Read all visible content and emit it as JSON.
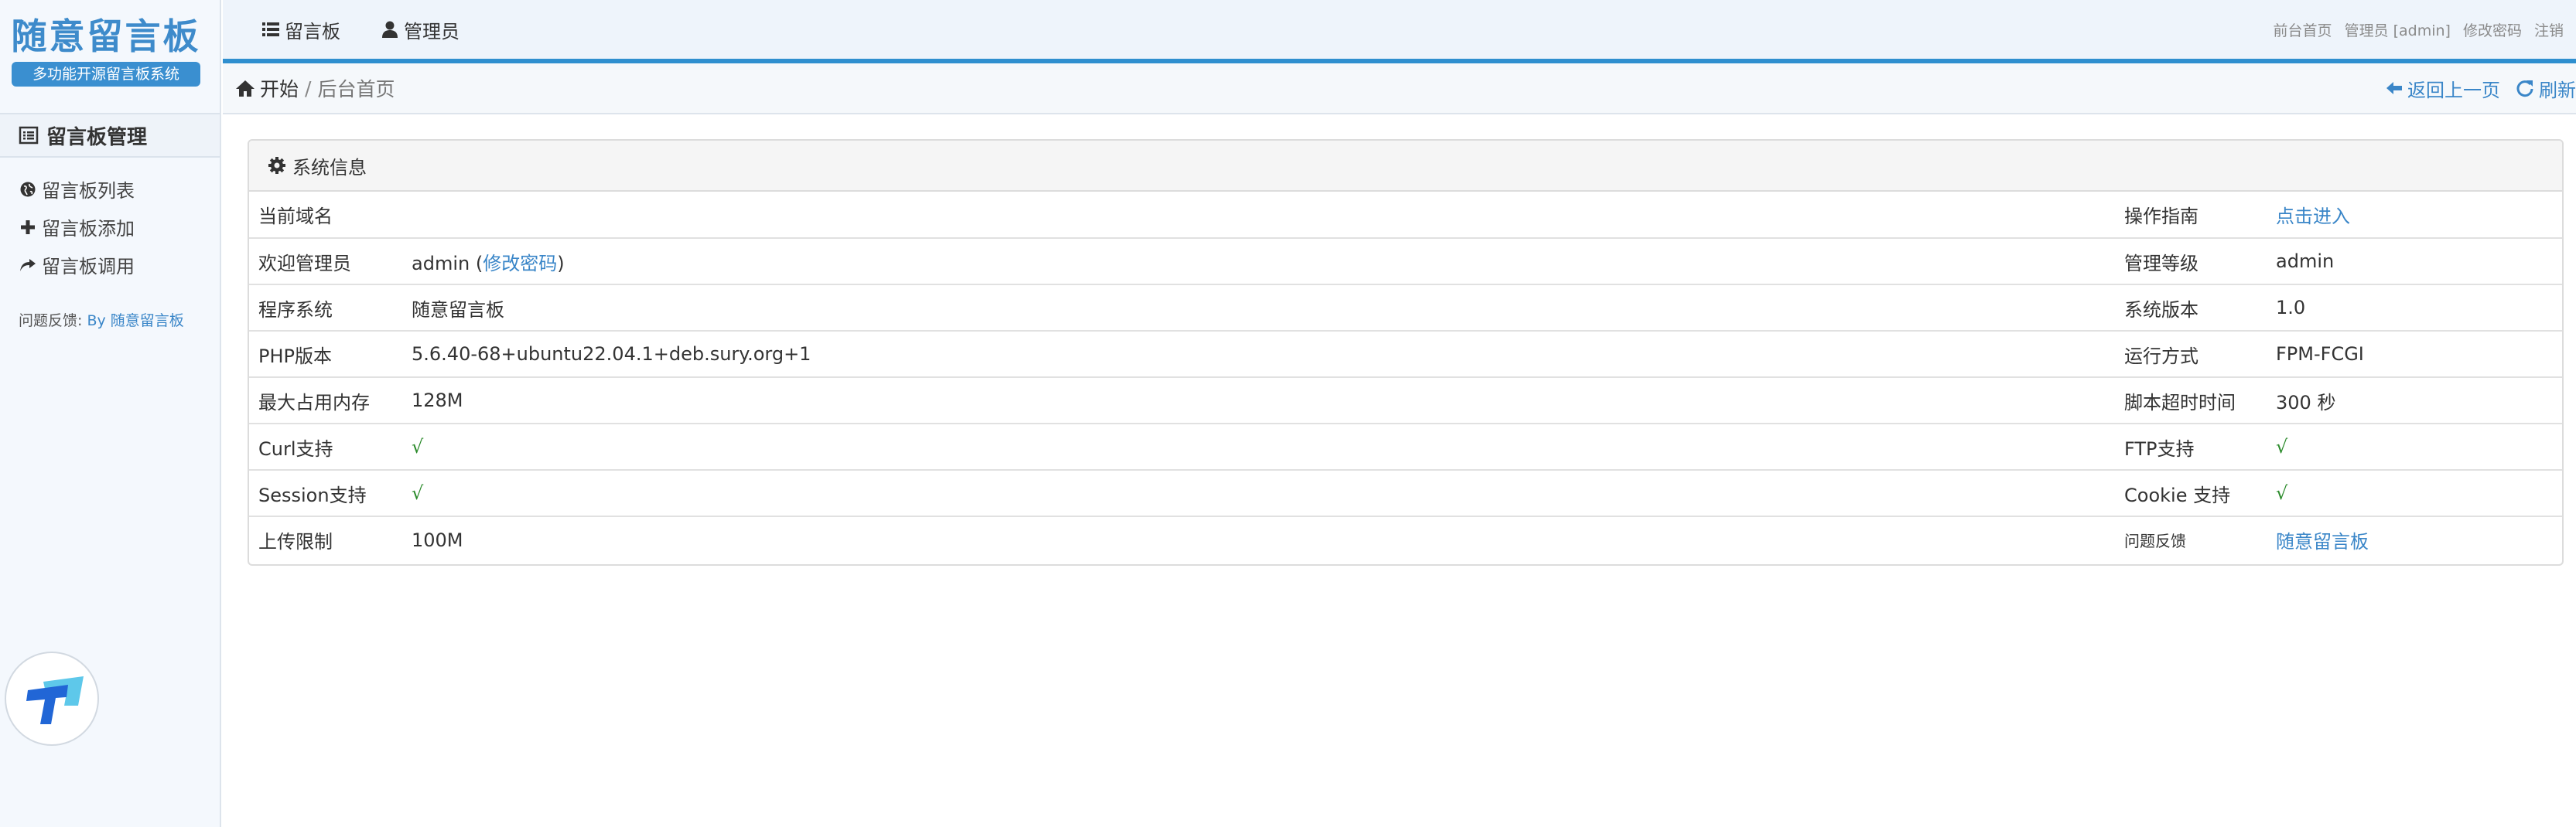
{
  "sidebar": {
    "logo_title": "随意留言板",
    "logo_subtitle": "多功能开源留言板系统",
    "section_title": "留言板管理",
    "items": [
      {
        "label": "留言板列表",
        "icon": "globe-icon"
      },
      {
        "label": "留言板添加",
        "icon": "plus-icon"
      },
      {
        "label": "留言板调用",
        "icon": "share-icon"
      }
    ],
    "feedback_label": "问题反馈:",
    "feedback_link": "By 随意留言板"
  },
  "topnav": {
    "items": [
      {
        "label": "留言板",
        "icon": "list-icon"
      },
      {
        "label": "管理员",
        "icon": "user-icon"
      }
    ],
    "links": [
      "前台首页",
      "管理员 [admin]",
      "修改密码",
      "注销"
    ]
  },
  "breadcrumb": {
    "home": "开始",
    "separator": "/",
    "current": "后台首页",
    "back": "返回上一页",
    "refresh": "刷新"
  },
  "panel": {
    "title": "系统信息",
    "rows": [
      {
        "k1": "当前域名",
        "v1": "",
        "k2": "操作指南",
        "v2": "点击进入"
      },
      {
        "k1": "欢迎管理员",
        "v1_name": "admin",
        "v1_link": "修改密码",
        "k2": "管理等级",
        "v2": "admin"
      },
      {
        "k1": "程序系统",
        "v1": "随意留言板",
        "k2": "系统版本",
        "v2": "1.0"
      },
      {
        "k1": "PHP版本",
        "v1": "5.6.40-68+ubuntu22.04.1+deb.sury.org+1",
        "k2": "运行方式",
        "v2": "FPM-FCGI"
      },
      {
        "k1": "最大占用内存",
        "v1": "128M",
        "k2": "脚本超时时间",
        "v2": "300 秒"
      },
      {
        "k1": "Curl支持",
        "v1": "√",
        "k2": "FTP支持",
        "v2": "√"
      },
      {
        "k1": "Session支持",
        "v1": "√",
        "k2": "Cookie 支持",
        "v2": "√"
      },
      {
        "k1": "上传限制",
        "v1": "100M",
        "k2": "问题反馈",
        "v2": "随意留言板"
      }
    ]
  },
  "colors": {
    "accent": "#2f8fcf",
    "link": "#3a86c8",
    "check": "#2a8a2a"
  }
}
